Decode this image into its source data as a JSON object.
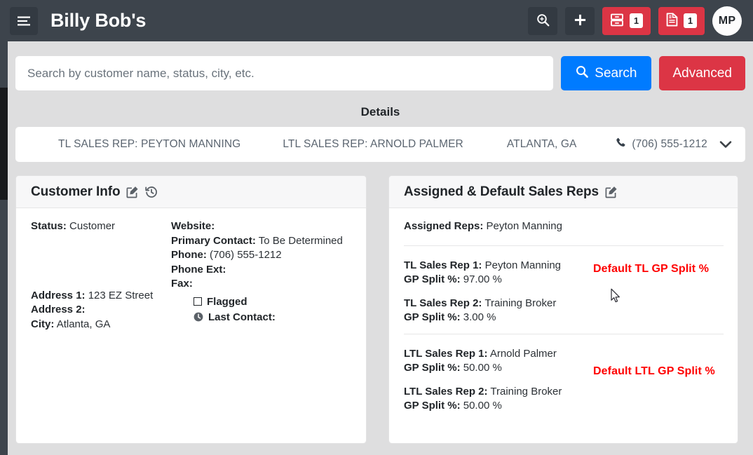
{
  "navbar": {
    "menu_icon": "hamburger-icon",
    "brand": "Billy Bob's",
    "actions": [
      {
        "icon": "search-plus-icon",
        "label": ""
      },
      {
        "icon": "plus-icon",
        "label": ""
      }
    ],
    "badges": [
      {
        "icon": "archive-boxes-icon",
        "count": "1",
        "color": "#dc3545"
      },
      {
        "icon": "file-invoice-icon",
        "count": "1",
        "color": "#dc3545"
      }
    ],
    "avatar_initials": "MP"
  },
  "search": {
    "value": "",
    "placeholder": "Search by customer name, status, city, etc.",
    "search_button": "Search",
    "search_icon": "search-icon",
    "advanced_button": "Advanced",
    "search_color": "#007bff",
    "advanced_color": "#dc3545"
  },
  "details": {
    "title": "Details",
    "summary": {
      "tl_sales_rep": "TL SALES REP: PEYTON MANNING",
      "ltl_sales_rep": "LTL SALES REP: ARNOLD PALMER",
      "location": "ATLANTA, GA",
      "phone": "(706) 555-1212",
      "phone_icon": "phone-icon",
      "expand_icon": "chevron-down-icon"
    }
  },
  "customer_info": {
    "title": "Customer Info",
    "edit_icon": "edit-pencil-icon",
    "history_icon": "history-clock-icon",
    "left": [
      {
        "label": "Status:",
        "value": "Customer"
      },
      {
        "label": "Address 1:",
        "value": "123 EZ Street"
      },
      {
        "label": "Address 2:",
        "value": ""
      },
      {
        "label": "City:",
        "value": "Atlanta, GA"
      }
    ],
    "right": [
      {
        "label": "Website:",
        "value": ""
      },
      {
        "label": "Primary Contact:",
        "value": "To Be Determined"
      },
      {
        "label": "Phone:",
        "value": "(706) 555-1212"
      },
      {
        "label": "Phone Ext:",
        "value": ""
      },
      {
        "label": "Fax:",
        "value": ""
      }
    ],
    "flagged_label": "Flagged",
    "flagged_checked": false,
    "last_contact_label": "Last Contact:",
    "last_contact_value": ""
  },
  "sales_reps": {
    "title": "Assigned & Default Sales Reps",
    "edit_icon": "edit-pencil-icon",
    "assigned": {
      "label": "Assigned Reps:",
      "value": "Peyton Manning"
    },
    "tl": {
      "rep1_label": "TL Sales Rep 1:",
      "rep1_value": "Peyton Manning",
      "split1_label": "GP Split %:",
      "split1_value": "97.00 %",
      "rep2_label": "TL Sales Rep 2:",
      "rep2_value": "Training Broker",
      "split2_label": "GP Split %:",
      "split2_value": "3.00 %",
      "default_note": "Default TL GP Split %"
    },
    "ltl": {
      "rep1_label": "LTL Sales Rep 1:",
      "rep1_value": "Arnold Palmer",
      "split1_label": "GP Split %:",
      "split1_value": "50.00 %",
      "rep2_label": "LTL Sales Rep 2:",
      "rep2_value": "Training Broker",
      "split2_label": "GP Split %:",
      "split2_value": "50.00 %",
      "default_note": "Default LTL GP Split %"
    },
    "note_color": "#ff0000"
  }
}
